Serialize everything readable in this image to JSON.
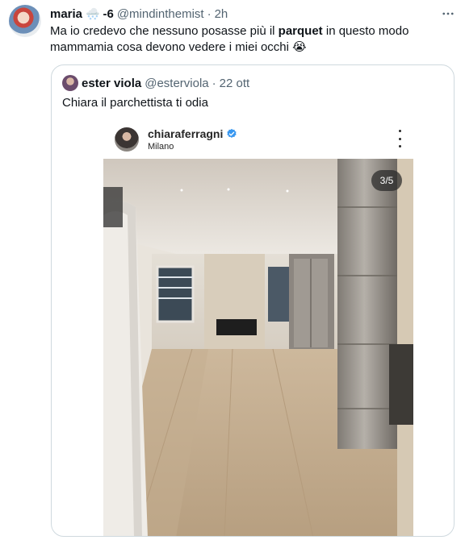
{
  "tweet": {
    "author_name": "maria",
    "author_emoji": "🌨️",
    "author_suffix": "-6",
    "handle": "@mindinthemist",
    "separator": "·",
    "time": "2h",
    "more_icon": "more-horizontal-icon",
    "text_before": "Ma io credevo che nessuno posasse più il ",
    "text_bold": "parquet",
    "text_after": " in questo modo",
    "text_line2": "mammamia cosa devono vedere i miei occhi",
    "text_emoji": "😭"
  },
  "quote": {
    "author_name": "ester viola",
    "handle": "@esterviola",
    "separator": "·",
    "time": "22 ott",
    "text": "Chiara il parchettista ti odia"
  },
  "instagram": {
    "username": "chiaraferragni",
    "location": "Milano",
    "verified_icon": "verified-badge-icon",
    "counter": "3/5",
    "colors": {
      "verified": "#3897f0"
    }
  }
}
